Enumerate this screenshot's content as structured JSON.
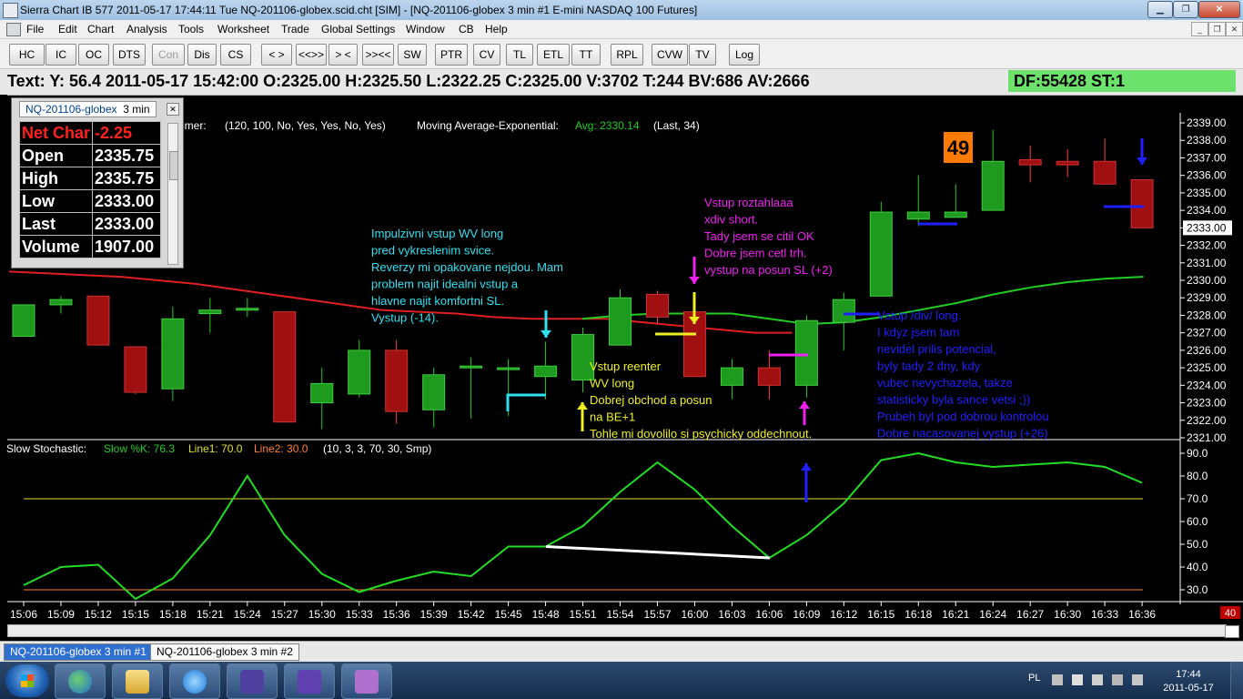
{
  "window": {
    "title": "Sierra Chart IB 577  2011-05-17  17:44:11  Tue   NQ-201106-globex.scid.cht [SIM]  - [NQ-201106-globex  3 min   #1  E-mini NASDAQ 100 Futures]"
  },
  "menu": [
    "File",
    "Edit",
    "Chart",
    "Analysis",
    "Tools",
    "Worksheet",
    "Trade",
    "Global Settings",
    "Window",
    "CB",
    "Help"
  ],
  "toolbar": [
    "HC",
    "IC",
    "OC",
    "DTS",
    "Con",
    "Dis",
    "CS",
    "< >",
    "<<>>",
    "> <",
    ">><<",
    "SW",
    "PTR",
    "CV",
    "TL",
    "ETL",
    "TT",
    "RPL",
    "CVW",
    "TV",
    "Log"
  ],
  "info": {
    "text": "Text: Y: 56.4   2011-05-17   15:42:00   O:2325.00   H:2325.50   L:2322.25   C:2325.00   V:3702   T:244   BV:686   AV:2666",
    "df": "DF:55428  ST:1"
  },
  "data_window": {
    "tab_symbol": "NQ-201106-globex",
    "tab_period": "3 min",
    "rows": [
      {
        "key": "Net Char",
        "value": "-2.25",
        "style": "red"
      },
      {
        "key": "Open",
        "value": "2335.75"
      },
      {
        "key": "High",
        "value": "2335.75"
      },
      {
        "key": "Low",
        "value": "2333.00"
      },
      {
        "key": "Last",
        "value": "2333.00"
      },
      {
        "key": "Volume",
        "value": "1907.00"
      }
    ]
  },
  "study_line": {
    "prefix": "imer:",
    "params": "(120, 100, No, Yes, Yes, No, Yes)",
    "ma_name": "Moving Average-Exponential:",
    "ma_value": "Avg: 2330.14",
    "ma_params": "(Last, 34)"
  },
  "stoch_line": {
    "name": "Slow Stochastic:",
    "k": "Slow %K: 76.3",
    "l1": "Line1: 70.0",
    "l2": "Line2: 30.0",
    "params": "(10, 3, 3, 70, 30, Smp)"
  },
  "bar_counter": "49",
  "scroll_value": "40",
  "price_labels": [
    "2339.00",
    "2338.00",
    "2337.00",
    "2336.00",
    "2335.00",
    "2334.00",
    "2333.00",
    "2332.00",
    "2331.00",
    "2330.00",
    "2329.00",
    "2328.00",
    "2327.00",
    "2326.00",
    "2325.00",
    "2324.00",
    "2323.00",
    "2322.00",
    "2321.00"
  ],
  "current_price": "2333.00",
  "stoch_labels": [
    "90.0",
    "80.0",
    "70.0",
    "60.0",
    "50.0",
    "40.0",
    "30.0"
  ],
  "time_labels": [
    "15:06",
    "15:09",
    "15:12",
    "15:15",
    "15:18",
    "15:21",
    "15:24",
    "15:27",
    "15:30",
    "15:33",
    "15:36",
    "15:39",
    "15:42",
    "15:45",
    "15:48",
    "15:51",
    "15:54",
    "15:57",
    "16:00",
    "16:03",
    "16:06",
    "16:09",
    "16:12",
    "16:15",
    "16:18",
    "16:21",
    "16:24",
    "16:27",
    "16:30",
    "16:33",
    "16:36"
  ],
  "annotations": {
    "cyan": [
      "Impulzivni vstup WV long",
      "pred vykreslenim svice.",
      "Reverzy mi opakovane nejdou. Mam",
      "problem najit idealni vstup a",
      "hlavne najit komfortni SL.",
      "Vystup (-14)."
    ],
    "yellow": [
      "Vstup reenter",
      "WV long",
      "Dobrej obchod a posun",
      "na BE+1",
      "Tohle mi dovolilo si psychicky oddechnout."
    ],
    "magenta": [
      "Vstup roztahlaaa",
      "xdiv short.",
      "Tady jsem se citil OK",
      "Dobre jsem cetl trh.",
      "vystup na posun SL (+2)"
    ],
    "blue": [
      "Vstup /div/ long.",
      "I kdyz jsem tam",
      "nevidel prilis potencial,",
      "byly tady 2 dny, kdy",
      "vubec nevychazela, takze",
      "statisticky byla sance vetsi ;))",
      "Prubeh byl pod dobrou kontrolou",
      "Dobre nacasovanej vystup (+26)"
    ]
  },
  "chart_data": {
    "type": "candlestick",
    "symbol": "NQ-201106-globex",
    "period": "3 min",
    "candles": [
      {
        "t": "15:06",
        "o": 2326.8,
        "h": 2328.6,
        "l": 2326.8,
        "c": 2328.6
      },
      {
        "t": "15:07",
        "o": 2328.6,
        "h": 2329.1,
        "l": 2328.1,
        "c": 2328.9
      },
      {
        "t": "15:09",
        "o": 2329.1,
        "h": 2329.1,
        "l": 2326.3,
        "c": 2326.3
      },
      {
        "t": "15:12",
        "o": 2326.2,
        "h": 2326.2,
        "l": 2323.5,
        "c": 2323.6
      },
      {
        "t": "15:15",
        "o": 2323.8,
        "h": 2328.5,
        "l": 2323.1,
        "c": 2327.8
      },
      {
        "t": "15:18",
        "o": 2328.1,
        "h": 2329.0,
        "l": 2327.0,
        "c": 2328.3
      },
      {
        "t": "15:21",
        "o": 2328.3,
        "h": 2329.0,
        "l": 2327.9,
        "c": 2328.4
      },
      {
        "t": "15:24",
        "o": 2328.2,
        "h": 2328.2,
        "l": 2321.9,
        "c": 2321.9
      },
      {
        "t": "15:27",
        "o": 2323.0,
        "h": 2325.0,
        "l": 2321.5,
        "c": 2324.1
      },
      {
        "t": "15:30",
        "o": 2323.5,
        "h": 2326.6,
        "l": 2323.3,
        "c": 2326.0
      },
      {
        "t": "15:33",
        "o": 2326.0,
        "h": 2326.6,
        "l": 2321.8,
        "c": 2322.5
      },
      {
        "t": "15:36",
        "o": 2322.6,
        "h": 2325.0,
        "l": 2321.6,
        "c": 2324.6
      },
      {
        "t": "15:39",
        "o": 2325.0,
        "h": 2325.6,
        "l": 2322.1,
        "c": 2325.1
      },
      {
        "t": "15:42",
        "o": 2325.0,
        "h": 2325.5,
        "l": 2322.25,
        "c": 2325.0
      },
      {
        "t": "15:45",
        "o": 2324.5,
        "h": 2326.5,
        "l": 2323.2,
        "c": 2325.1
      },
      {
        "t": "15:48",
        "o": 2324.3,
        "h": 2327.3,
        "l": 2323.6,
        "c": 2326.9
      },
      {
        "t": "15:51",
        "o": 2326.3,
        "h": 2329.5,
        "l": 2326.3,
        "c": 2329.0
      },
      {
        "t": "15:54",
        "o": 2329.2,
        "h": 2329.4,
        "l": 2327.5,
        "c": 2327.9
      },
      {
        "t": "15:57",
        "o": 2328.2,
        "h": 2328.2,
        "l": 2324.5,
        "c": 2324.5
      },
      {
        "t": "16:00",
        "o": 2324.0,
        "h": 2325.5,
        "l": 2323.2,
        "c": 2325.0
      },
      {
        "t": "16:03",
        "o": 2325.0,
        "h": 2326.0,
        "l": 2323.2,
        "c": 2324.0
      },
      {
        "t": "16:06",
        "o": 2324.0,
        "h": 2328.0,
        "l": 2323.3,
        "c": 2327.7
      },
      {
        "t": "16:09",
        "o": 2327.6,
        "h": 2329.3,
        "l": 2326.0,
        "c": 2328.9
      },
      {
        "t": "16:12",
        "o": 2329.1,
        "h": 2334.5,
        "l": 2329.1,
        "c": 2333.9
      },
      {
        "t": "16:15",
        "o": 2333.5,
        "h": 2336.0,
        "l": 2333.1,
        "c": 2333.9
      },
      {
        "t": "16:18",
        "o": 2333.6,
        "h": 2335.5,
        "l": 2333.6,
        "c": 2333.9
      },
      {
        "t": "16:21",
        "o": 2334.0,
        "h": 2338.6,
        "l": 2334.0,
        "c": 2336.8
      },
      {
        "t": "16:24",
        "o": 2336.9,
        "h": 2337.7,
        "l": 2335.6,
        "c": 2336.6
      },
      {
        "t": "16:27",
        "o": 2336.8,
        "h": 2337.5,
        "l": 2335.9,
        "c": 2336.6
      },
      {
        "t": "16:30",
        "o": 2336.8,
        "h": 2338.1,
        "l": 2335.5,
        "c": 2335.5
      },
      {
        "t": "16:33",
        "o": 2335.75,
        "h": 2335.75,
        "l": 2333.0,
        "c": 2333.0
      }
    ],
    "stoch_k": [
      32,
      40,
      41,
      26,
      35,
      54,
      80,
      54,
      37,
      29,
      34,
      38,
      36,
      49,
      49,
      58,
      73,
      86,
      74,
      58,
      44,
      54,
      68,
      87,
      90,
      86,
      84,
      85,
      86,
      84,
      77
    ],
    "red_ma": [
      2330.5,
      2330.4,
      2330.3,
      2330.2,
      2330.0,
      2329.8,
      2329.5,
      2329.2,
      2328.9,
      2328.6,
      2328.3,
      2328.2,
      2328.1,
      2327.9,
      2327.8,
      2327.8,
      2327.8,
      2327.6,
      2327.4,
      2327.2,
      2327.0,
      2327.0
    ],
    "green_ma": [
      2327.8,
      2328.0,
      2328.1,
      2328.1,
      2328.1,
      2327.8,
      2327.5,
      2327.6,
      2327.9,
      2328.3,
      2328.7,
      2329.2,
      2329.6,
      2329.9,
      2330.1,
      2330.2
    ],
    "price_range": [
      2320.5,
      2339.3
    ],
    "stoch_range": [
      27,
      95
    ],
    "line1": 70,
    "line2": 30
  }
}
